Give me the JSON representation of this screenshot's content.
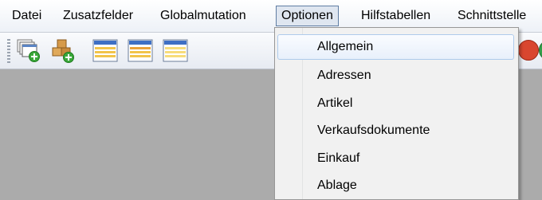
{
  "menubar": {
    "items": [
      {
        "label": "Datei"
      },
      {
        "label": "Zusatzfelder"
      },
      {
        "label": "Globalmutation"
      },
      {
        "label": "Optionen"
      },
      {
        "label": "Hilfstabellen"
      },
      {
        "label": "Schnittstelle"
      }
    ]
  },
  "toolbar": {
    "buttons": [
      {
        "icon": "window-add-icon"
      },
      {
        "icon": "boxes-add-icon"
      },
      {
        "icon": "list-blue-icon"
      },
      {
        "icon": "list-orange-icon"
      },
      {
        "icon": "list-yellow-icon"
      }
    ]
  },
  "dropdown": {
    "items": [
      {
        "label": "Allgemein"
      },
      {
        "label": "Adressen"
      },
      {
        "label": "Artikel"
      },
      {
        "label": "Verkaufsdokumente"
      },
      {
        "label": "Einkauf"
      },
      {
        "label": "Ablage"
      }
    ]
  }
}
